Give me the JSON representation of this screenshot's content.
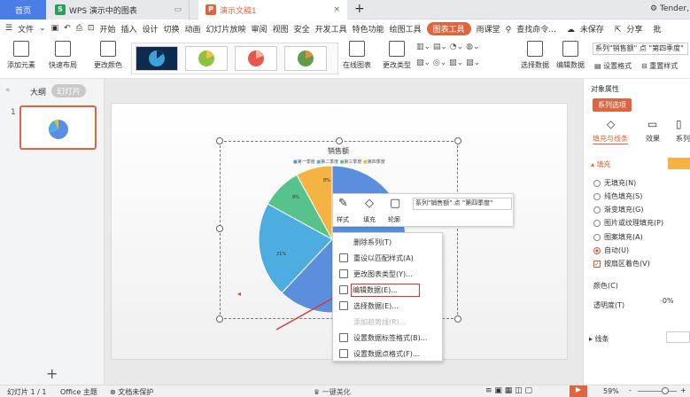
{
  "tabs": {
    "home": "首页",
    "doc1": "WPS 演示中的图表",
    "doc2": "演示文稿1",
    "add": "+",
    "user": "Tender,"
  },
  "menu": {
    "file": "文件",
    "items": [
      "开始",
      "插入",
      "设计",
      "切换",
      "动画",
      "幻灯片放映",
      "审阅",
      "视图",
      "安全",
      "开发工具",
      "特色功能",
      "绘图工具"
    ],
    "chart_tools": "图表工具",
    "rain": "雨课堂",
    "search": "查找命令...",
    "unsaved": "未保存",
    "share": "分享",
    "comment": "批"
  },
  "ribbon": {
    "add_element": "添加元素",
    "quick_layout": "快速布局",
    "change_color": "更改颜色",
    "online_chart": "在线图表",
    "change_type": "更改类型",
    "select_data": "选择数据",
    "edit_data": "编辑数据",
    "series_select": "系列\"销售额\" 点 \"第四季度\"",
    "set_format": "设置格式",
    "reset_style": "重置样式"
  },
  "left": {
    "outline": "大纲",
    "slides": "幻灯片",
    "slide_num": "1",
    "add": "+"
  },
  "chart": {
    "title": "销售额",
    "legend": [
      "第一季度",
      "第二季度",
      "第三季度",
      "第四季度"
    ],
    "labels": [
      "8%",
      "9%",
      "21%"
    ]
  },
  "chart_data": {
    "type": "pie",
    "title": "销售额",
    "categories": [
      "第一季度",
      "第二季度",
      "第三季度",
      "第四季度"
    ],
    "values": [
      62,
      21,
      9,
      8
    ],
    "colors": [
      "#5b8fde",
      "#4dade0",
      "#57c28b",
      "#f5b343"
    ]
  },
  "mini_toolbar": {
    "style": "样式",
    "fill": "填充",
    "outline": "轮廓",
    "series": "系列\"销售额\" 点 \"第四季度\""
  },
  "context_menu": [
    "删除系列(T)",
    "重设以匹配样式(A)",
    "更改图表类型(Y)...",
    "编辑数据(E)...",
    "选择数据(E)...",
    "添加趋势线(R)...",
    "设置数据标签格式(B)...",
    "设置数据点格式(F)..."
  ],
  "right": {
    "props": "对象属性",
    "series_opts": "系列选项",
    "fill_line": "填充与线条",
    "effect": "效果",
    "series": "系列",
    "fill": "填充",
    "options": [
      "无填充(N)",
      "纯色填充(S)",
      "渐变填充(G)",
      "图片或纹理填充(P)",
      "图案填充(A)",
      "自动(U)"
    ],
    "by_region": "按扇区着色(V)",
    "color": "颜色(C)",
    "transparency": "透明度(T)",
    "transparency_val": "0%",
    "line": "线条"
  },
  "status": {
    "slide": "幻灯片 1 / 1",
    "theme": "Office 主题",
    "protect": "文档未保护",
    "beautify": "一键美化",
    "zoom": "59%",
    "minus": "-",
    "plus": "+"
  }
}
